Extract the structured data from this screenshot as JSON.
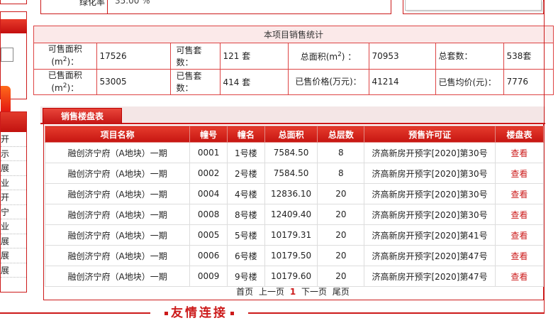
{
  "top": {
    "green_rate_label": "绿化率",
    "green_rate_value": "35.00 %"
  },
  "sidebar": {
    "items": [
      "开",
      "示",
      "展",
      "业",
      "开",
      "宁",
      "业",
      "展",
      "展",
      "展"
    ]
  },
  "stats": {
    "title": "本项目销售统计",
    "row1": {
      "sale_area_label": "可售面积(m²)：",
      "sale_area_value": "17526",
      "sale_units_label": "可售套数：",
      "sale_units_value": "121 套",
      "total_area_label": "总面积(m²) ：",
      "total_area_value": "70953",
      "total_units_label": "总套数：",
      "total_units_value": "538套"
    },
    "row2": {
      "sold_area_label": "已售面积(m²)：",
      "sold_area_value": "53005",
      "sold_units_label": "已售套数：",
      "sold_units_value": "414 套",
      "sold_price_label": "已售价格(万元)：",
      "sold_price_value": "41214",
      "avg_price_label": "已售均价(元)：",
      "avg_price_value": "7776"
    }
  },
  "sales": {
    "tab_label": "销售楼盘表",
    "columns": [
      "项目名称",
      "幢号",
      "幢名",
      "总面积",
      "总层数",
      "预售许可证",
      "楼盘表"
    ],
    "rows": [
      {
        "project": "融创济宁府（A地块）一期",
        "no": "0001",
        "name": "1号楼",
        "area": "7584.50",
        "floors": "8",
        "permit": "济高新房开预字[2020]第30号",
        "action": "查看"
      },
      {
        "project": "融创济宁府（A地块）一期",
        "no": "0002",
        "name": "2号楼",
        "area": "7584.50",
        "floors": "8",
        "permit": "济高新房开预字[2020]第30号",
        "action": "查看"
      },
      {
        "project": "融创济宁府（A地块）一期",
        "no": "0004",
        "name": "4号楼",
        "area": "12836.10",
        "floors": "20",
        "permit": "济高新房开预字[2020]第30号",
        "action": "查看"
      },
      {
        "project": "融创济宁府（A地块）一期",
        "no": "0008",
        "name": "8号楼",
        "area": "12409.40",
        "floors": "20",
        "permit": "济高新房开预字[2020]第30号",
        "action": "查看"
      },
      {
        "project": "融创济宁府（A地块）一期",
        "no": "0005",
        "name": "5号楼",
        "area": "10179.31",
        "floors": "20",
        "permit": "济高新房开预字[2020]第41号",
        "action": "查看"
      },
      {
        "project": "融创济宁府（A地块）一期",
        "no": "0006",
        "name": "6号楼",
        "area": "10179.50",
        "floors": "20",
        "permit": "济高新房开预字[2020]第47号",
        "action": "查看"
      },
      {
        "project": "融创济宁府（A地块）一期",
        "no": "0009",
        "name": "9号楼",
        "area": "10179.60",
        "floors": "20",
        "permit": "济高新房开预字[2020]第47号",
        "action": "查看"
      }
    ],
    "pager": {
      "first": "首页",
      "prev": "上一页",
      "current": "1",
      "next": "下一页",
      "last": "尾页"
    }
  },
  "friendly_links": {
    "title": "友情连接"
  },
  "colors": {
    "accent": "#cc1a1a",
    "header_bg": "#fbe9e9"
  }
}
